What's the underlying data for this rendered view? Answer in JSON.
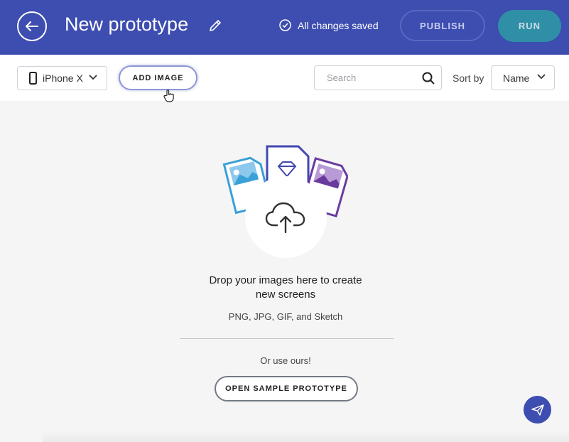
{
  "header": {
    "title": "New prototype",
    "saved_status": "All changes saved",
    "publish_label": "PUBLISH",
    "run_label": "RUN",
    "colors": {
      "bar": "#3d4db0",
      "run": "#2f8fa6"
    }
  },
  "toolbar": {
    "device_label": "iPhone X",
    "add_image_label": "ADD IMAGE",
    "search_placeholder": "Search",
    "sort_label": "Sort by",
    "sort_value": "Name"
  },
  "empty_state": {
    "headline_line1": "Drop your images here to create",
    "headline_line2": "new screens",
    "formats": "PNG, JPG, GIF, and Sketch",
    "alt_text": "Or use ours!",
    "sample_button_label": "OPEN SAMPLE PROTOTYPE"
  },
  "icons": {
    "back": "arrow-left-icon",
    "edit": "pencil-icon",
    "saved": "check-circle-icon",
    "device": "phone-icon",
    "chevron": "chevron-down-icon",
    "search": "search-icon",
    "upload": "cloud-upload-icon",
    "fab": "paper-plane-icon"
  }
}
